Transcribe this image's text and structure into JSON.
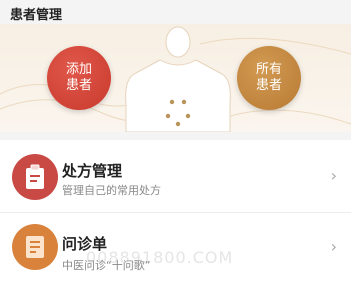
{
  "header": {
    "title": "患者管理"
  },
  "hero": {
    "add_patient_label": "添加患者",
    "all_patients_label": "所有患者",
    "accent_add": "#c8392c",
    "accent_all": "#b87a34"
  },
  "cards": [
    {
      "title": "处方管理",
      "subtitle": "管理自己的常用处方",
      "icon": "prescription-clipboard-icon"
    },
    {
      "title": "问诊单",
      "subtitle": "中医问诊“十问歌”",
      "icon": "consultation-form-icon"
    }
  ],
  "watermark": "008891800.COM"
}
